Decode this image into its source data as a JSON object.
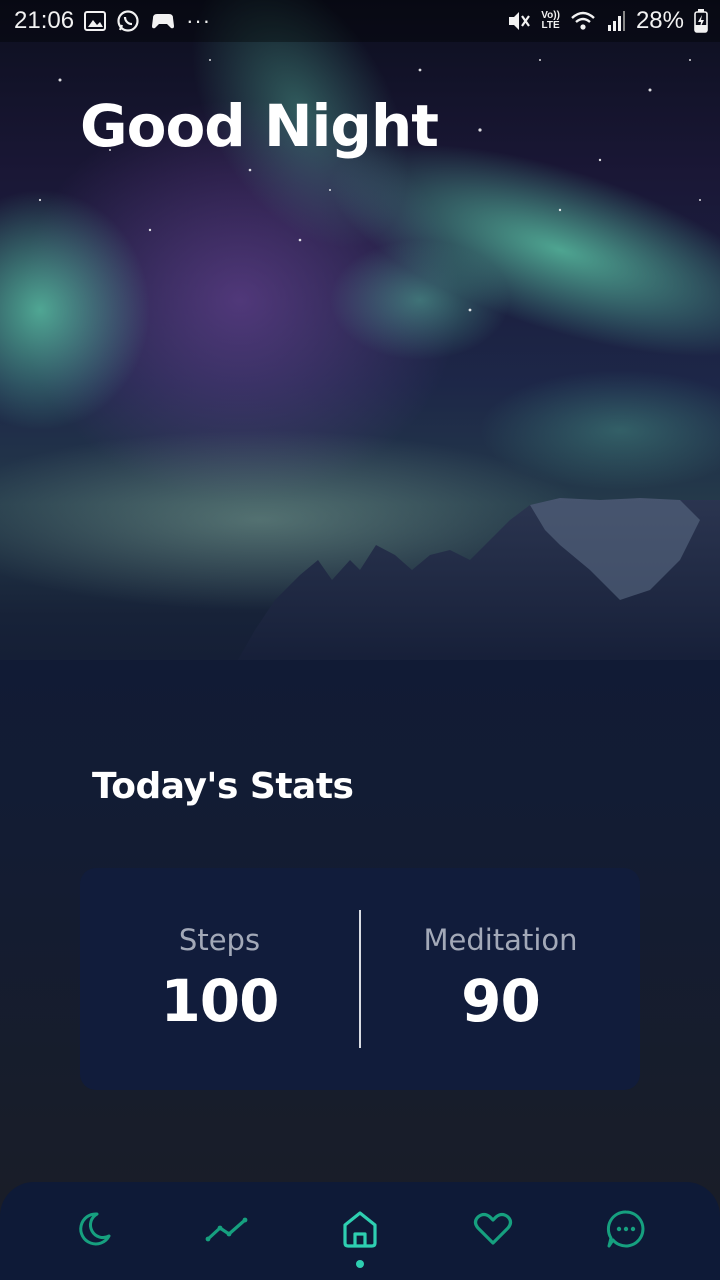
{
  "status_bar": {
    "time": "21:06",
    "battery": "28%",
    "left_icons": [
      "image-icon",
      "whatsapp-icon",
      "game-icon",
      "more-dots-icon"
    ],
    "right_icons": [
      "mute-icon",
      "volte-icon",
      "wifi-icon",
      "signal-icon",
      "battery-charging-icon"
    ],
    "volte_top": "Vo))",
    "volte_bottom": "LTE",
    "more_dots": "···"
  },
  "hero": {
    "greeting": "Good Night",
    "image": "aurora-mountain-night-photo"
  },
  "stats": {
    "title": "Today's Stats",
    "items": [
      {
        "label": "Steps",
        "value": "100"
      },
      {
        "label": "Meditation",
        "value": "90"
      }
    ]
  },
  "nav": {
    "items": [
      {
        "icon": "moon-icon",
        "active": false
      },
      {
        "icon": "trend-chart-icon",
        "active": false
      },
      {
        "icon": "home-icon",
        "active": true
      },
      {
        "icon": "heart-icon",
        "active": false
      },
      {
        "icon": "chat-bubble-icon",
        "active": false
      }
    ],
    "active_color": "#2ecfb1",
    "inactive_color": "#16a07f"
  },
  "colors": {
    "background": "#121a2e",
    "card": "#111c3b",
    "nav_bar": "#0e1a37",
    "accent": "#2ecfb1"
  }
}
